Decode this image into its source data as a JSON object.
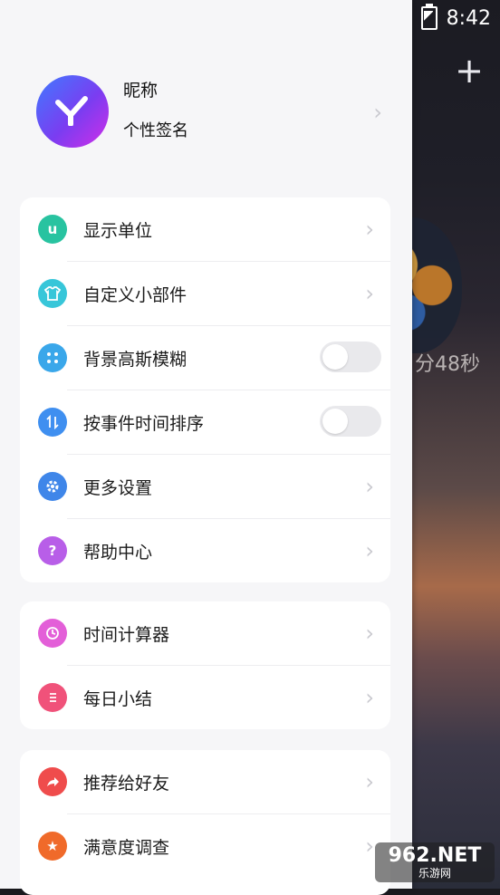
{
  "status_bar": {
    "time": "8:42"
  },
  "background": {
    "timer_text": "分48秒",
    "add_icon": "plus-icon"
  },
  "profile": {
    "nickname": "昵称",
    "signature": "个性签名"
  },
  "menu": {
    "group1": [
      {
        "label": "显示单位",
        "icon": "unit-icon",
        "color": "#28c3a0",
        "type": "arrow"
      },
      {
        "label": "自定义小部件",
        "icon": "shirt-icon",
        "color": "#37c6d9",
        "type": "arrow"
      },
      {
        "label": "背景高斯模糊",
        "icon": "dots-icon",
        "color": "#3aa7ea",
        "type": "toggle",
        "value": false
      },
      {
        "label": "按事件时间排序",
        "icon": "sort-icon",
        "color": "#3f8ff0",
        "type": "toggle",
        "value": false
      },
      {
        "label": "更多设置",
        "icon": "gear-icon",
        "color": "#3f86e9",
        "type": "arrow"
      },
      {
        "label": "帮助中心",
        "icon": "question-icon",
        "color": "#b85ee8",
        "type": "arrow"
      }
    ],
    "group2": [
      {
        "label": "时间计算器",
        "icon": "clock-icon",
        "color": "#e35fd8",
        "type": "arrow"
      },
      {
        "label": "每日小结",
        "icon": "list-icon",
        "color": "#f0527a",
        "type": "arrow"
      }
    ],
    "group3": [
      {
        "label": "推荐给好友",
        "icon": "share-icon",
        "color": "#ef4c4c",
        "type": "arrow"
      },
      {
        "label": "满意度调查",
        "icon": "star-icon",
        "color": "#f06a2a",
        "type": "arrow"
      }
    ]
  },
  "watermark": {
    "text": "962.NET",
    "subtext": "乐游网"
  }
}
